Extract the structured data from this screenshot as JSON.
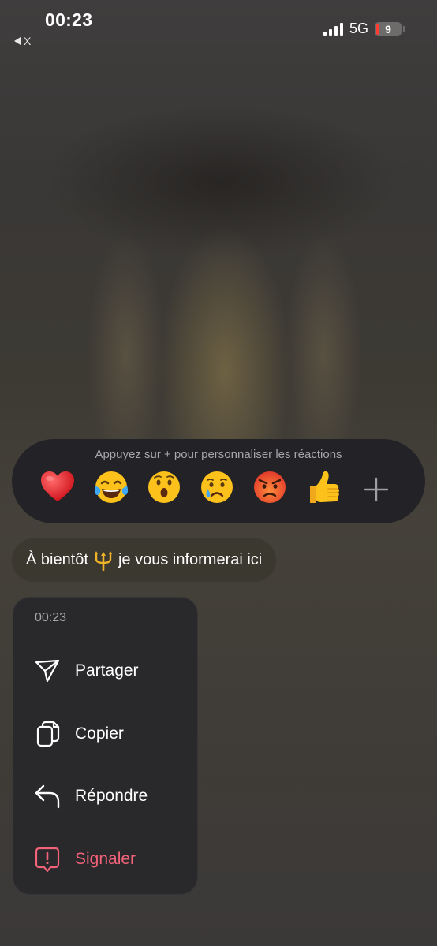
{
  "status_bar": {
    "time": "00:23",
    "back_app": "X",
    "network": "5G",
    "battery": "9"
  },
  "reactions": {
    "hint": "Appuyez sur + pour personnaliser les réactions",
    "items": [
      "heart",
      "tears-of-joy",
      "surprised",
      "crying",
      "angry",
      "thumbs-up"
    ],
    "add_icon": "plus-icon"
  },
  "message": {
    "before": "À bientôt",
    "emoji": "trident",
    "after": "je vous informerai ici"
  },
  "context_menu": {
    "time": "00:23",
    "items": [
      {
        "label": "Partager",
        "icon": "share-icon"
      },
      {
        "label": "Copier",
        "icon": "copy-icon"
      },
      {
        "label": "Répondre",
        "icon": "reply-icon"
      },
      {
        "label": "Signaler",
        "icon": "report-icon"
      }
    ]
  },
  "colors": {
    "danger": "#f2637a",
    "menu_bg": "#29282a",
    "reaction_bar_bg": "#232227",
    "bubble_bg": "#3b3830"
  }
}
